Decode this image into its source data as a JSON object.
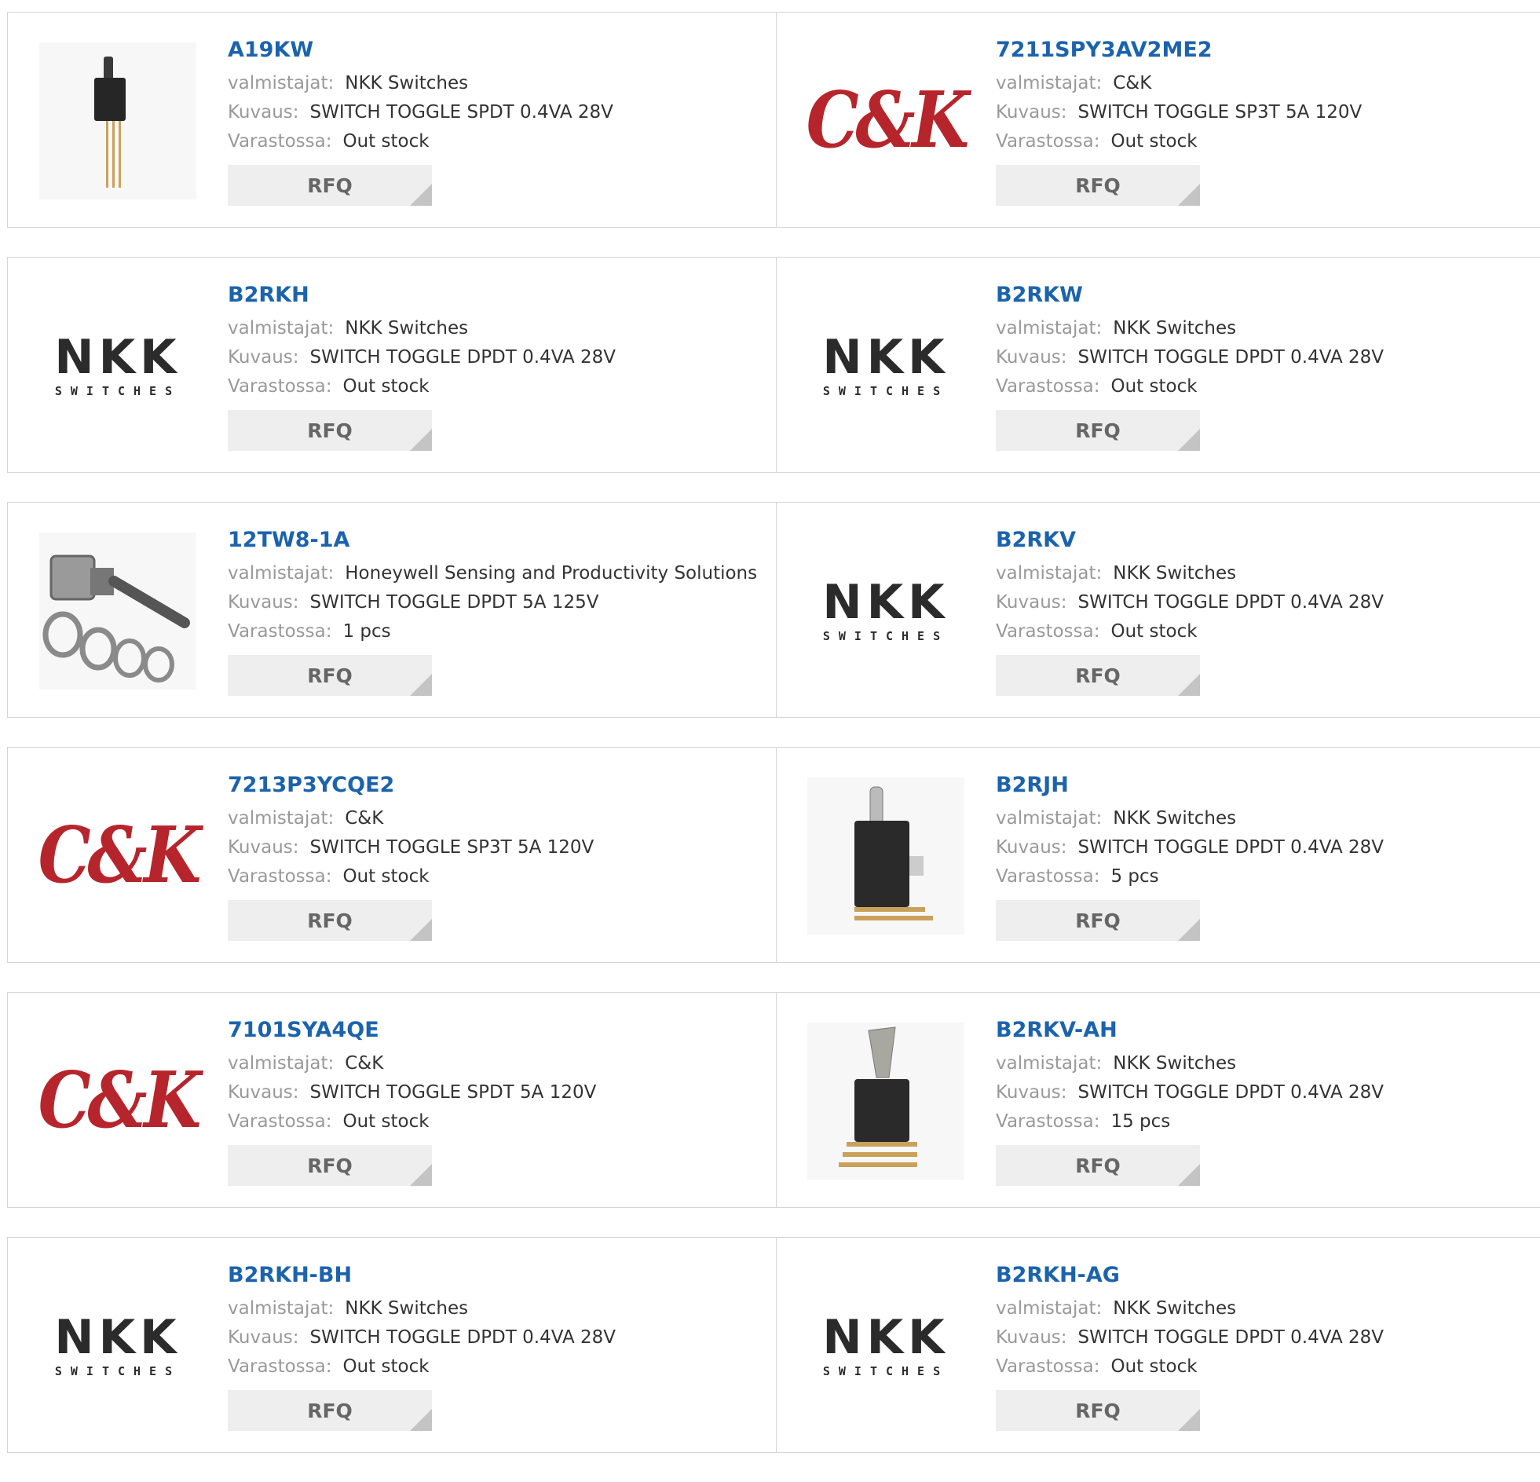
{
  "labels": {
    "manufacturer": "valmistajat:",
    "description": "Kuvaus:",
    "stock": "Varastossa:",
    "rfq": "RFQ"
  },
  "logos": {
    "ck": "C&K",
    "nkk_top": "NKK",
    "nkk_sub": "SWITCHES"
  },
  "colors": {
    "link": "#1c63ad",
    "ck_red": "#b7252c",
    "rfq_bg": "#eeeeee"
  },
  "products": [
    {
      "part": "A19KW",
      "manufacturer": "NKK Switches",
      "description": "SWITCH TOGGLE SPDT 0.4VA 28V",
      "stock": "Out stock",
      "image": "toggle-switch-pins-photo"
    },
    {
      "part": "7211SPY3AV2ME2",
      "manufacturer": "C&K",
      "description": "SWITCH TOGGLE SP3T 5A 120V",
      "stock": "Out stock",
      "image": "ck-logo"
    },
    {
      "part": "B2RKH",
      "manufacturer": "NKK Switches",
      "description": "SWITCH TOGGLE DPDT 0.4VA 28V",
      "stock": "Out stock",
      "image": "nkk-logo"
    },
    {
      "part": "B2RKW",
      "manufacturer": "NKK Switches",
      "description": "SWITCH TOGGLE DPDT 0.4VA 28V",
      "stock": "Out stock",
      "image": "nkk-logo"
    },
    {
      "part": "12TW8-1A",
      "manufacturer": "Honeywell Sensing and Productivity Solutions",
      "description": "SWITCH TOGGLE DPDT 5A 125V",
      "stock": "1 pcs",
      "image": "toggle-switch-nuts-photo"
    },
    {
      "part": "B2RKV",
      "manufacturer": "NKK Switches",
      "description": "SWITCH TOGGLE DPDT 0.4VA 28V",
      "stock": "Out stock",
      "image": "nkk-logo"
    },
    {
      "part": "7213P3YCQE2",
      "manufacturer": "C&K",
      "description": "SWITCH TOGGLE SP3T 5A 120V",
      "stock": "Out stock",
      "image": "ck-logo"
    },
    {
      "part": "B2RJH",
      "manufacturer": "NKK Switches",
      "description": "SWITCH TOGGLE DPDT 0.4VA 28V",
      "stock": "5 pcs",
      "image": "toggle-switch-angled-photo"
    },
    {
      "part": "7101SYA4QE",
      "manufacturer": "C&K",
      "description": "SWITCH TOGGLE SPDT 5A 120V",
      "stock": "Out stock",
      "image": "ck-logo"
    },
    {
      "part": "B2RKV-AH",
      "manufacturer": "NKK Switches",
      "description": "SWITCH TOGGLE DPDT 0.4VA 28V",
      "stock": "15 pcs",
      "image": "toggle-switch-paddle-photo"
    },
    {
      "part": "B2RKH-BH",
      "manufacturer": "NKK Switches",
      "description": "SWITCH TOGGLE DPDT 0.4VA 28V",
      "stock": "Out stock",
      "image": "nkk-logo"
    },
    {
      "part": "B2RKH-AG",
      "manufacturer": "NKK Switches",
      "description": "SWITCH TOGGLE DPDT 0.4VA 28V",
      "stock": "Out stock",
      "image": "nkk-logo"
    }
  ]
}
